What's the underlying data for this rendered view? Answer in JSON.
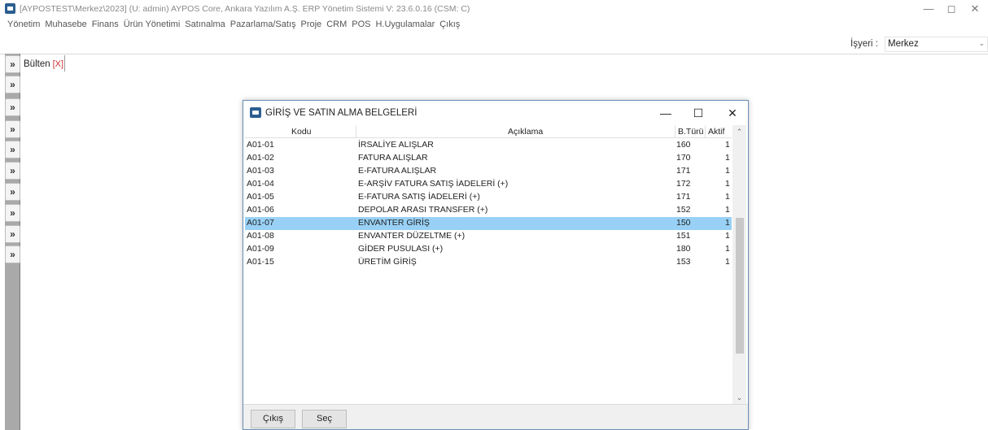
{
  "window": {
    "title": "[AYPOSTEST\\Merkez\\2023] (U: admin) AYPOS Core, Ankara Yazılım A.Ş. ERP Yönetim Sistemi V: 23.6.0.16 (CSM: C)",
    "minimize": "—",
    "maximize": "◻",
    "close": "✕"
  },
  "menu": [
    "Yönetim",
    "Muhasebe",
    "Finans",
    "Ürün Yönetimi",
    "Satınalma",
    "Pazarlama/Satış",
    "Proje",
    "CRM",
    "POS",
    "H.Uygulamalar",
    "Çıkış"
  ],
  "workplace": {
    "label": "İşyeri :",
    "value": "Merkez",
    "chevron_icon": "chevron-down"
  },
  "tabs": {
    "bulten_label": "Bülten",
    "bulten_close": "[X]"
  },
  "sidebar": {
    "button_glyph": "»",
    "button_count": 10
  },
  "dialog": {
    "title": "GİRİŞ VE SATIN ALMA BELGELERİ",
    "minimize": "—",
    "maximize": "☐",
    "close": "✕",
    "columns": {
      "kodu": "Kodu",
      "aciklama": "Açıklama",
      "bturu": "B.Türü",
      "aktif": "Aktif"
    },
    "rows": [
      {
        "kodu": "A01-01",
        "aciklama": "İRSALİYE ALIŞLAR",
        "bturu": "160",
        "aktif": "1"
      },
      {
        "kodu": "A01-02",
        "aciklama": "FATURA ALIŞLAR",
        "bturu": "170",
        "aktif": "1"
      },
      {
        "kodu": "A01-03",
        "aciklama": "E-FATURA ALIŞLAR",
        "bturu": "171",
        "aktif": "1"
      },
      {
        "kodu": "A01-04",
        "aciklama": "E-ARŞİV FATURA SATIŞ İADELERİ (+)",
        "bturu": "172",
        "aktif": "1"
      },
      {
        "kodu": "A01-05",
        "aciklama": "E-FATURA SATIŞ İADELERİ (+)",
        "bturu": "171",
        "aktif": "1"
      },
      {
        "kodu": "A01-06",
        "aciklama": "DEPOLAR ARASI TRANSFER (+)",
        "bturu": "152",
        "aktif": "1"
      },
      {
        "kodu": "A01-07",
        "aciklama": "ENVANTER GİRİŞ",
        "bturu": "150",
        "aktif": "1"
      },
      {
        "kodu": "A01-08",
        "aciklama": "ENVANTER DÜZELTME (+)",
        "bturu": "151",
        "aktif": "1"
      },
      {
        "kodu": "A01-09",
        "aciklama": "GİDER PUSULASI (+)",
        "bturu": "180",
        "aktif": "1"
      },
      {
        "kodu": "A01-15",
        "aciklama": "ÜRETİM GİRİŞ",
        "bturu": "153",
        "aktif": "1"
      }
    ],
    "selected_row": 6,
    "buttons": {
      "cikis": "Çıkış",
      "sec": "Seç"
    }
  },
  "colors": {
    "selection": "#99d1f6",
    "dialog_border": "#6a8fb5",
    "sidebar_bg": "#a9a9a9",
    "close_tab": "#cc3333"
  }
}
